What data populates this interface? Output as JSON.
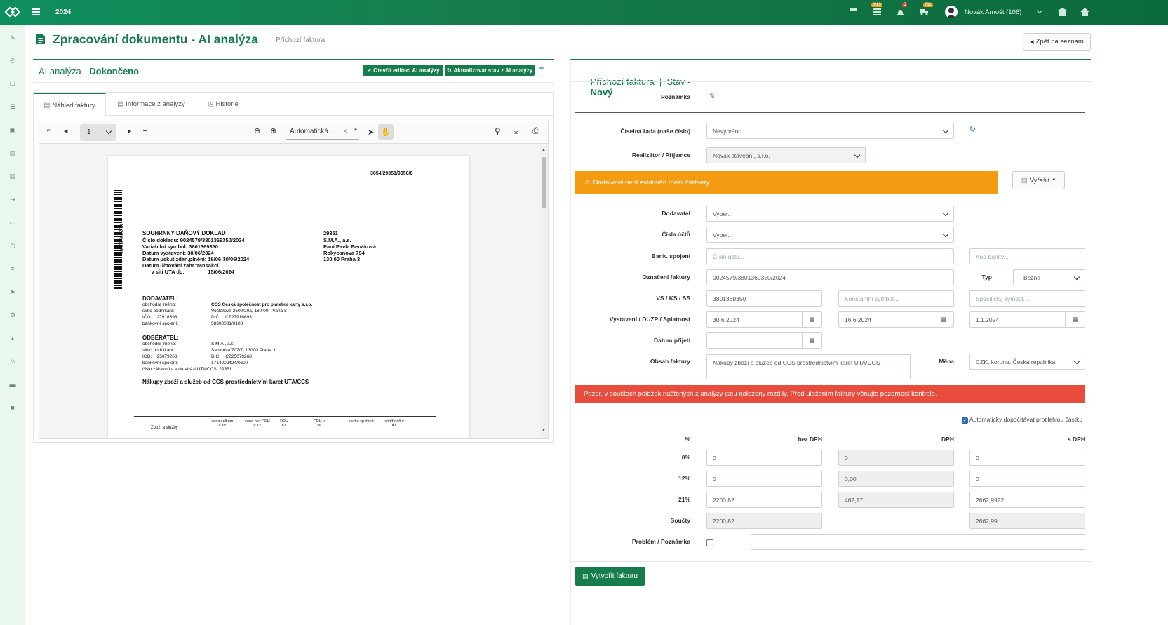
{
  "topbar": {
    "year": "2024",
    "user": "Novák Arnošt (106)",
    "badges": [
      "0/13",
      "5",
      "711"
    ]
  },
  "sidebar": {
    "icons": [
      "pencil-icon",
      "clock-icon",
      "bookmark-icon",
      "boxes-icon",
      "cube-icon",
      "file-icon",
      "file-icon",
      "file-export-icon",
      "ticket-icon",
      "clock-icon",
      "chart-icon",
      "send-icon",
      "gears-icon",
      "bell-icon",
      "users-icon",
      "folder-icon",
      "book-icon"
    ]
  },
  "page": {
    "title": "Zpracování dokumentu - AI analýza",
    "subtitle": "Příchozí faktura",
    "back_label": "Zpět na seznam"
  },
  "left": {
    "heading_prefix": "AI analýza -",
    "heading_state": "Dokončeno",
    "btn_open": "Otevřít editaci AI analýzy",
    "btn_update": "Aktualizovat stav z AI analýzy",
    "tabs": [
      "Náhled faktury",
      "Informace z analýzy",
      "Historie"
    ],
    "viewer": {
      "page": "1",
      "zoom": "Automatická..."
    }
  },
  "doc": {
    "top_ref": "3054/29351/9350/6",
    "barcode_text": "0023951000*",
    "title": "SOUHRNNÝ DAŇOVÝ DOKLAD",
    "lines": [
      "Číslo dokladu:    9024579/3801369350/2024",
      "Variabilní symbol:                3801369350",
      "Datum vystavení:                 30/06/2024",
      "Datum uskut.zdan.plnění:   16/06-30/06/2024",
      "Datum účtování zahr.transakcí",
      "      v síti UTA do:                15/06/2024"
    ],
    "right": [
      "29351",
      "S.M.A., a.s.",
      "Paní Pavla Benáková",
      "Rokycanova 794",
      "130 00 Praha 3"
    ],
    "supplier_head": "DODAVATEL:",
    "supplier": [
      "obchodní jméno:",
      "sídlo podnikání:",
      "IČO:    27916693",
      "bankovní spojení:"
    ],
    "supplier_vals": [
      "CCS Česká společnost pro platební karty s.r.o.",
      "Voctářova 2500/20a, 180 00, Praha 8",
      "DIČ:    CZ27916693",
      "58300081/0100"
    ],
    "buyer_head": "ODBĚRATEL:",
    "buyer": [
      "obchodní jméno:",
      "sídlo podnikání:",
      "IČO:    25079268",
      "bankovní spojení:",
      "číslo zákazníka v databázi UTA/CCS: 29351"
    ],
    "buyer_vals": [
      "S.M.A., a.s.",
      "Sabinova 707/7, 13000 Praha 3",
      "DIČ:    CZ25079268",
      "1714002424/0600"
    ],
    "summary": "Nákupy zboží a služeb od CCS prostřednictvím karet UTA/CCS",
    "cols": [
      "Zboží a služby",
      "cena celkem v Kč",
      "cena bez DPH v Kč",
      "DPH Kč",
      "DPH v %",
      "sazba sp.daně",
      "spotř.daň v Kč"
    ]
  },
  "right": {
    "heading_prefix": "Příchozí faktura  |  Stav -",
    "heading_state": "Nový",
    "labels": {
      "note": "Poznámka",
      "series": "Číselná řada (naše číslo)",
      "realizer": "Realizátor / Příjemce",
      "supplier": "Dodavatel",
      "accounts": "Čísla účtů",
      "bank": "Bank. spojení",
      "invoice_no": "Označení faktury",
      "type": "Typ",
      "vs": "VS / KS / SS",
      "dates": "Vystavení / DUZP / Splatnost",
      "received": "Datum přijetí",
      "content": "Obsah faktury",
      "currency": "Měna",
      "problem": "Problém / Poznámka"
    },
    "values": {
      "series": "Nevybráno",
      "realizer": "Novák stavební, s.r.o.",
      "supplier": "Vyber...",
      "accounts": "Vyber...",
      "account_ph": "Číslo účtu...",
      "bank_ph": "Kód banky...",
      "invoice_no": "9024579/3801369350/2024",
      "type": "Běžná",
      "vs": "3801369350",
      "ks_ph": "Konstantní symbol...",
      "ss_ph": "Specifický symbol...",
      "issued": "30.6.2024",
      "duzp": "16.6.2024",
      "due": "1.1.2024",
      "received": "",
      "content": "Nákupy zboží a služeb od CCS prostřednictvím karet UTA/CCS",
      "currency": "CZK, koruna, Česká republika"
    },
    "warning": "Dodavatel není evidován mezi Partnery",
    "resolve": "Vyřešit",
    "alert": "Pozor, v součtech položek načtených z analýzy jsou nalezeny rozdíly. Před uložením faktury věnujte pozornost kontrole.",
    "auto_label": "Automaticky dopočítávat protilehlou částku",
    "vat_head": [
      "%",
      "bez DPH",
      "DPH",
      "s DPH"
    ],
    "vat_rows": [
      [
        "0%",
        "0",
        "0",
        "0"
      ],
      [
        "12%",
        "0",
        "0,00",
        "0"
      ],
      [
        "21%",
        "2200,82",
        "462,17",
        "2662,9922"
      ]
    ],
    "sum_label": "Součty",
    "sum_bez": "2200,82",
    "sum_s": "2662,99",
    "create": "Vytvořit fakturu"
  },
  "colors": {
    "brand": "#167c4c",
    "warning": "#f39c12",
    "danger": "#e74c3c"
  }
}
